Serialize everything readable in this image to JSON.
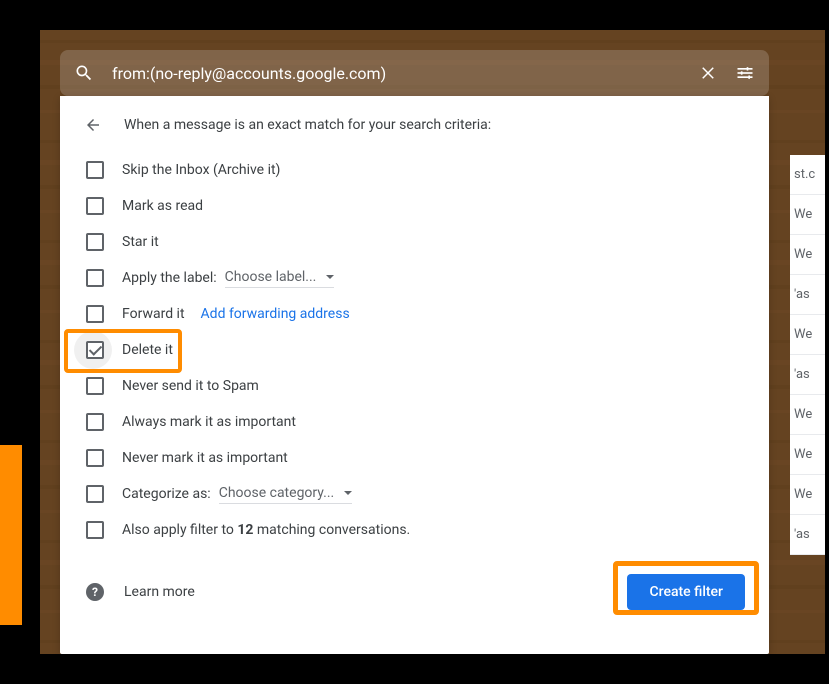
{
  "search": {
    "query": "from:(no-reply@accounts.google.com)"
  },
  "header": {
    "title": "When a message is an exact match for your search criteria:"
  },
  "options": {
    "skip_inbox": "Skip the Inbox (Archive it)",
    "mark_read": "Mark as read",
    "star_it": "Star it",
    "apply_label": "Apply the label:",
    "apply_label_dropdown": "Choose label...",
    "forward_it": "Forward it",
    "forward_link": "Add forwarding address",
    "delete_it": "Delete it",
    "never_spam": "Never send it to Spam",
    "always_important": "Always mark it as important",
    "never_important": "Never mark it as important",
    "categorize_as": "Categorize as:",
    "categorize_dropdown": "Choose category...",
    "also_apply_prefix": "Also apply filter to ",
    "also_apply_count": "12",
    "also_apply_suffix": " matching conversations."
  },
  "footer": {
    "learn_more": "Learn more",
    "create_filter": "Create filter"
  },
  "bg_snippets": [
    "st.c",
    "We",
    "We",
    "'as",
    "We",
    "'as",
    "We",
    "We",
    "We",
    "'as"
  ]
}
